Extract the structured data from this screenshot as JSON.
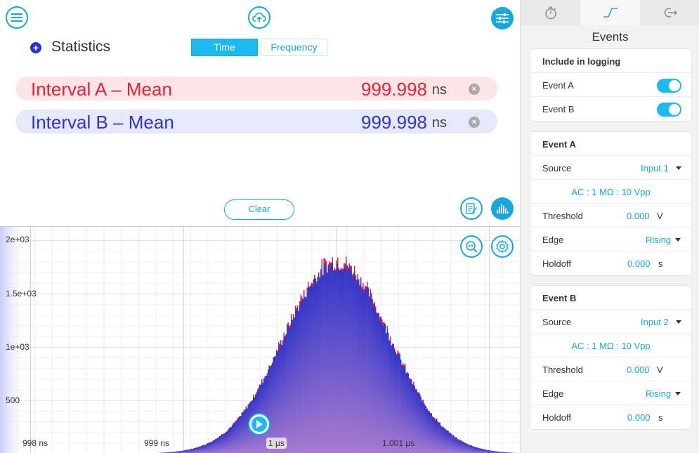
{
  "header": {
    "menu_icon": "menu-icon",
    "upload_icon": "cloud-upload-icon",
    "settings_icon": "sliders-icon"
  },
  "statistics": {
    "title": "Statistics",
    "tabs": [
      {
        "label": "Time",
        "active": true
      },
      {
        "label": "Frequency",
        "active": false
      }
    ],
    "intervals": [
      {
        "label": "Interval A – Mean",
        "value": "999.998",
        "unit": "ns",
        "color": "#e8203a"
      },
      {
        "label": "Interval B – Mean",
        "value": "999.998",
        "unit": "ns",
        "color": "#3236c8"
      }
    ],
    "clear_label": "Clear"
  },
  "chart_data": {
    "type": "bar",
    "title": "",
    "xlabel": "",
    "ylabel": "",
    "x_ticks": [
      "998 ns",
      "999 ns",
      "1 µs",
      "1.001 µs"
    ],
    "y_ticks": [
      "2e+03",
      "1.5e+03",
      "1e+03",
      "500"
    ],
    "xlim_ns": [
      997.8,
      1001.2
    ],
    "ylim": [
      0,
      2130
    ],
    "distribution": {
      "shape": "gaussian",
      "center_ns": 1000.0,
      "sigma_ns": 0.35,
      "peak": 1780
    },
    "series": [
      {
        "name": "Interval A",
        "color": "#e8203a"
      },
      {
        "name": "Interval B",
        "color": "#3236c8"
      }
    ],
    "grid": true
  },
  "sidebar": {
    "tabs": [
      {
        "icon": "stopwatch-icon",
        "active": false
      },
      {
        "icon": "edge-signal-icon",
        "active": true
      },
      {
        "icon": "export-icon",
        "active": false
      }
    ],
    "title": "Events",
    "logging": {
      "header": "Include in logging",
      "items": [
        {
          "label": "Event A",
          "on": true
        },
        {
          "label": "Event B",
          "on": true
        }
      ]
    },
    "events": [
      {
        "header": "Event A",
        "source_label": "Source",
        "source": "Input 1",
        "coupling": "AC : 1 MΩ : 10 Vpp",
        "threshold_label": "Threshold",
        "threshold": "0.000",
        "threshold_unit": "V",
        "edge_label": "Edge",
        "edge": "Rising",
        "holdoff_label": "Holdoff",
        "holdoff": "0.000",
        "holdoff_unit": "s"
      },
      {
        "header": "Event B",
        "source_label": "Source",
        "source": "Input 2",
        "coupling": "AC : 1 MΩ : 10 Vpp",
        "threshold_label": "Threshold",
        "threshold": "0.000",
        "threshold_unit": "V",
        "edge_label": "Edge",
        "edge": "Rising",
        "holdoff_label": "Holdoff",
        "holdoff": "0.000",
        "holdoff_unit": "s"
      }
    ]
  }
}
